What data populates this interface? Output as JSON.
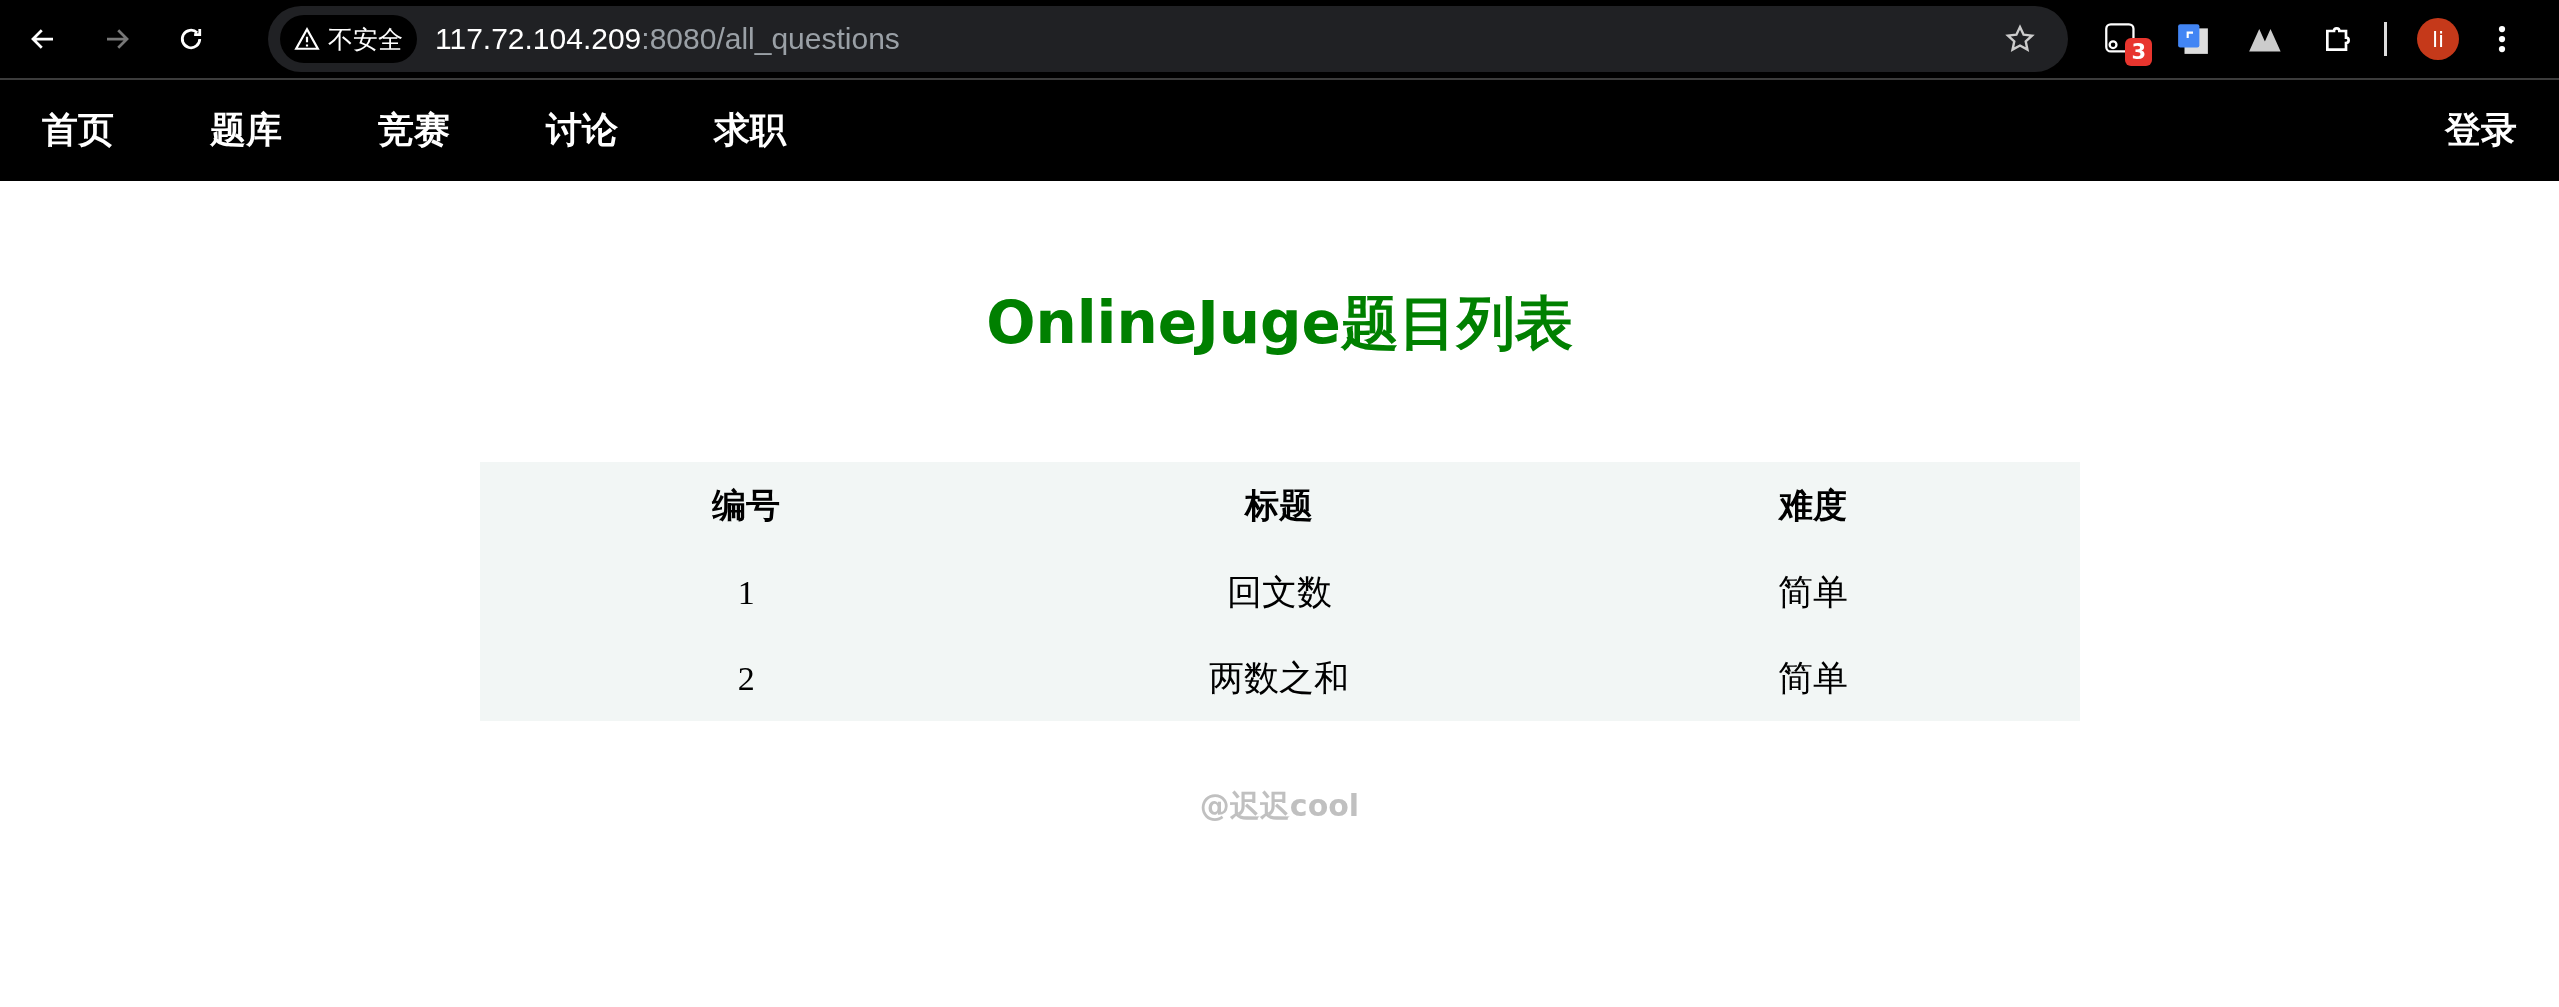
{
  "browser": {
    "security_label": "不安全",
    "url_host": "117.72.104.209",
    "url_rest": ":8080/all_questions",
    "extension_badge": "3",
    "avatar_initials": "li"
  },
  "nav": {
    "items": [
      "首页",
      "题库",
      "竞赛",
      "讨论",
      "求职"
    ],
    "login": "登录"
  },
  "title": "OnlineJuge题目列表",
  "table": {
    "columns": [
      "编号",
      "标题",
      "难度"
    ],
    "rows": [
      {
        "number": "1",
        "title": "回文数",
        "difficulty": "简单"
      },
      {
        "number": "2",
        "title": "两数之和",
        "difficulty": "简单"
      }
    ]
  },
  "footer": "@迟迟cool"
}
